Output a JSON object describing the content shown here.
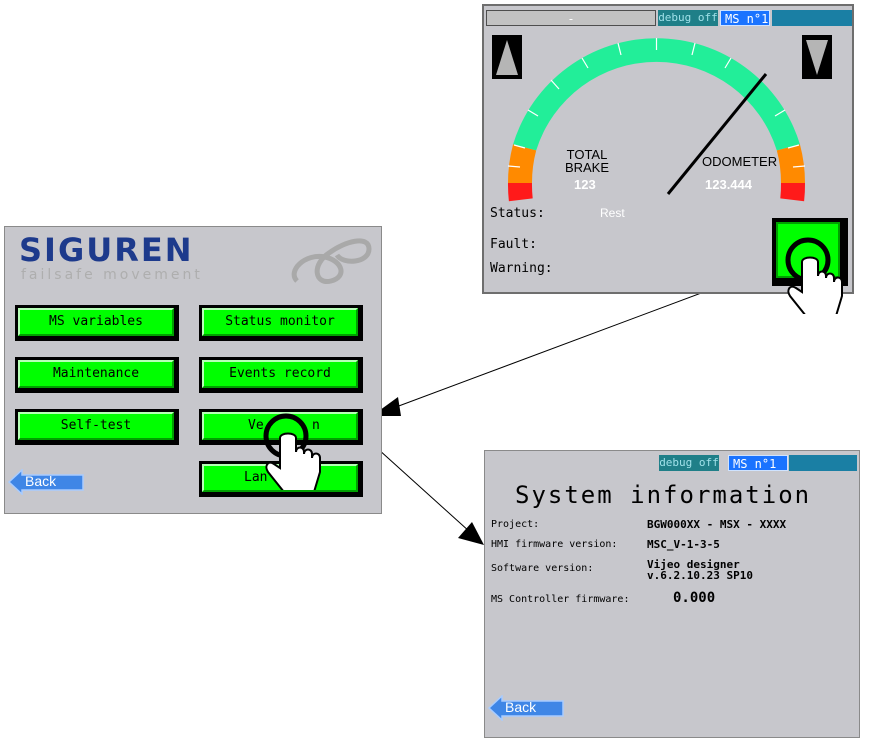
{
  "odometer_screen": {
    "header": {
      "blank_field": "-",
      "debug": "debug off",
      "ms": "MS n°1"
    },
    "gauge": {
      "total_brake_label_line1": "TOTAL",
      "total_brake_label_line2": "BRAKE",
      "total_brake_value": "123",
      "odometer_label": "ODOMETER",
      "odometer_value": "123.444"
    },
    "status_label": "Status:",
    "status_value": "Rest",
    "fault_label": "Fault:",
    "warning_label": "Warning:",
    "icons": [
      "arrow-up-icon",
      "arrow-down-icon",
      "pointer-hand-icon"
    ],
    "colors": {
      "gauge_green": "#22ee99",
      "gauge_orange": "#ff8a00",
      "gauge_red": "#ff1a1a"
    }
  },
  "main_menu": {
    "brand": "SIGUREN",
    "tagline": "failsafe movement",
    "buttons": {
      "ms_variables": "MS variables",
      "status_monitor": "Status monitor",
      "maintenance": "Maintenance",
      "events_record": "Events record",
      "self_test": "Self-test",
      "version_left": "Ve",
      "version_right": "n",
      "language_left": "Lan",
      "language_right": "s"
    },
    "back": "Back"
  },
  "system_info": {
    "header": {
      "debug": "debug off",
      "ms": "MS n°1"
    },
    "title": "System information",
    "rows": {
      "project_label": "Project:",
      "project_value": "BGW000XX - MSX - XXXX",
      "hmi_label": "HMI firmware version:",
      "hmi_value": "MSC_V-1-3-5",
      "software_label": "Software version:",
      "software_value_line1": "Vijeo designer",
      "software_value_line2": "v.6.2.10.23 SP10",
      "controller_label": "MS Controller firmware:",
      "controller_value": "0.000"
    },
    "back": "Back"
  }
}
